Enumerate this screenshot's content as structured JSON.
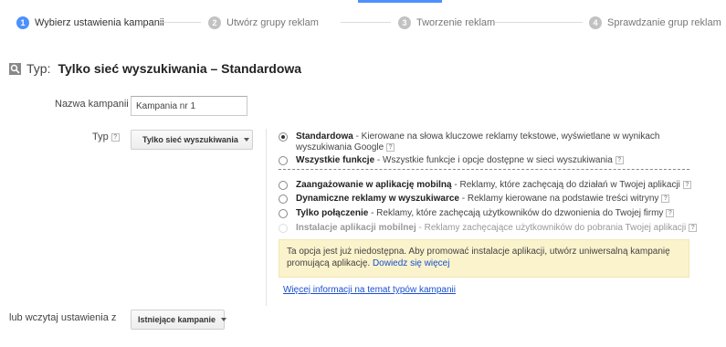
{
  "stepper": {
    "steps": [
      {
        "num": "1",
        "label": "Wybierz ustawienia kampanii"
      },
      {
        "num": "2",
        "label": "Utwórz grupy reklam"
      },
      {
        "num": "3",
        "label": "Tworzenie reklam"
      },
      {
        "num": "4",
        "label": "Sprawdzanie grup reklam"
      }
    ],
    "active_step": 1,
    "accent_color": "#4d90fe"
  },
  "header": {
    "prefix": "Typ:",
    "title": "Tylko sieć wyszukiwania – Standardowa",
    "icon": "search-icon"
  },
  "form": {
    "campaign_name_label": "Nazwa kampanii",
    "campaign_name_value": "Kampania nr 1",
    "type_label": "Typ",
    "type_dropdown": "Tylko sieć wyszukiwania",
    "help_glyph": "?",
    "load_label": "lub wczytaj ustawienia z",
    "load_dropdown": "Istniejące kampanie"
  },
  "options": [
    {
      "title": "Standardowa",
      "desc": " - Kierowane na słowa kluczowe reklamy tekstowe, wyświetlane w wynikach wyszukiwania Google",
      "checked": true,
      "disabled": false
    },
    {
      "title": "Wszystkie funkcje",
      "desc": " - Wszystkie funkcje i opcje dostępne w sieci wyszukiwania",
      "checked": false,
      "disabled": false
    },
    {
      "title": "Zaangażowanie w aplikację mobilną",
      "desc": " - Reklamy, które zachęcają do działań w Twojej aplikacji",
      "checked": false,
      "disabled": false
    },
    {
      "title": "Dynamiczne reklamy w wyszukiwarce",
      "desc": " - Reklamy kierowane na podstawie treści witryny",
      "checked": false,
      "disabled": false
    },
    {
      "title": "Tylko połączenie",
      "desc": " - Reklamy, które zachęcają użytkowników do dzwonienia do Twojej firmy",
      "checked": false,
      "disabled": false
    },
    {
      "title": "Instalacje aplikacji mobilnej",
      "desc": " - Reklamy zachęcające użytkowników do pobrania Twojej aplikacji",
      "checked": false,
      "disabled": true
    }
  ],
  "notice": {
    "text": "Ta opcja jest już niedostępna. Aby promować instalacje aplikacji, utwórz uniwersalną kampanię promującą aplikację.",
    "link": "Dowiedz się więcej"
  },
  "info_link": "Więcej informacji na temat typów kampanii"
}
